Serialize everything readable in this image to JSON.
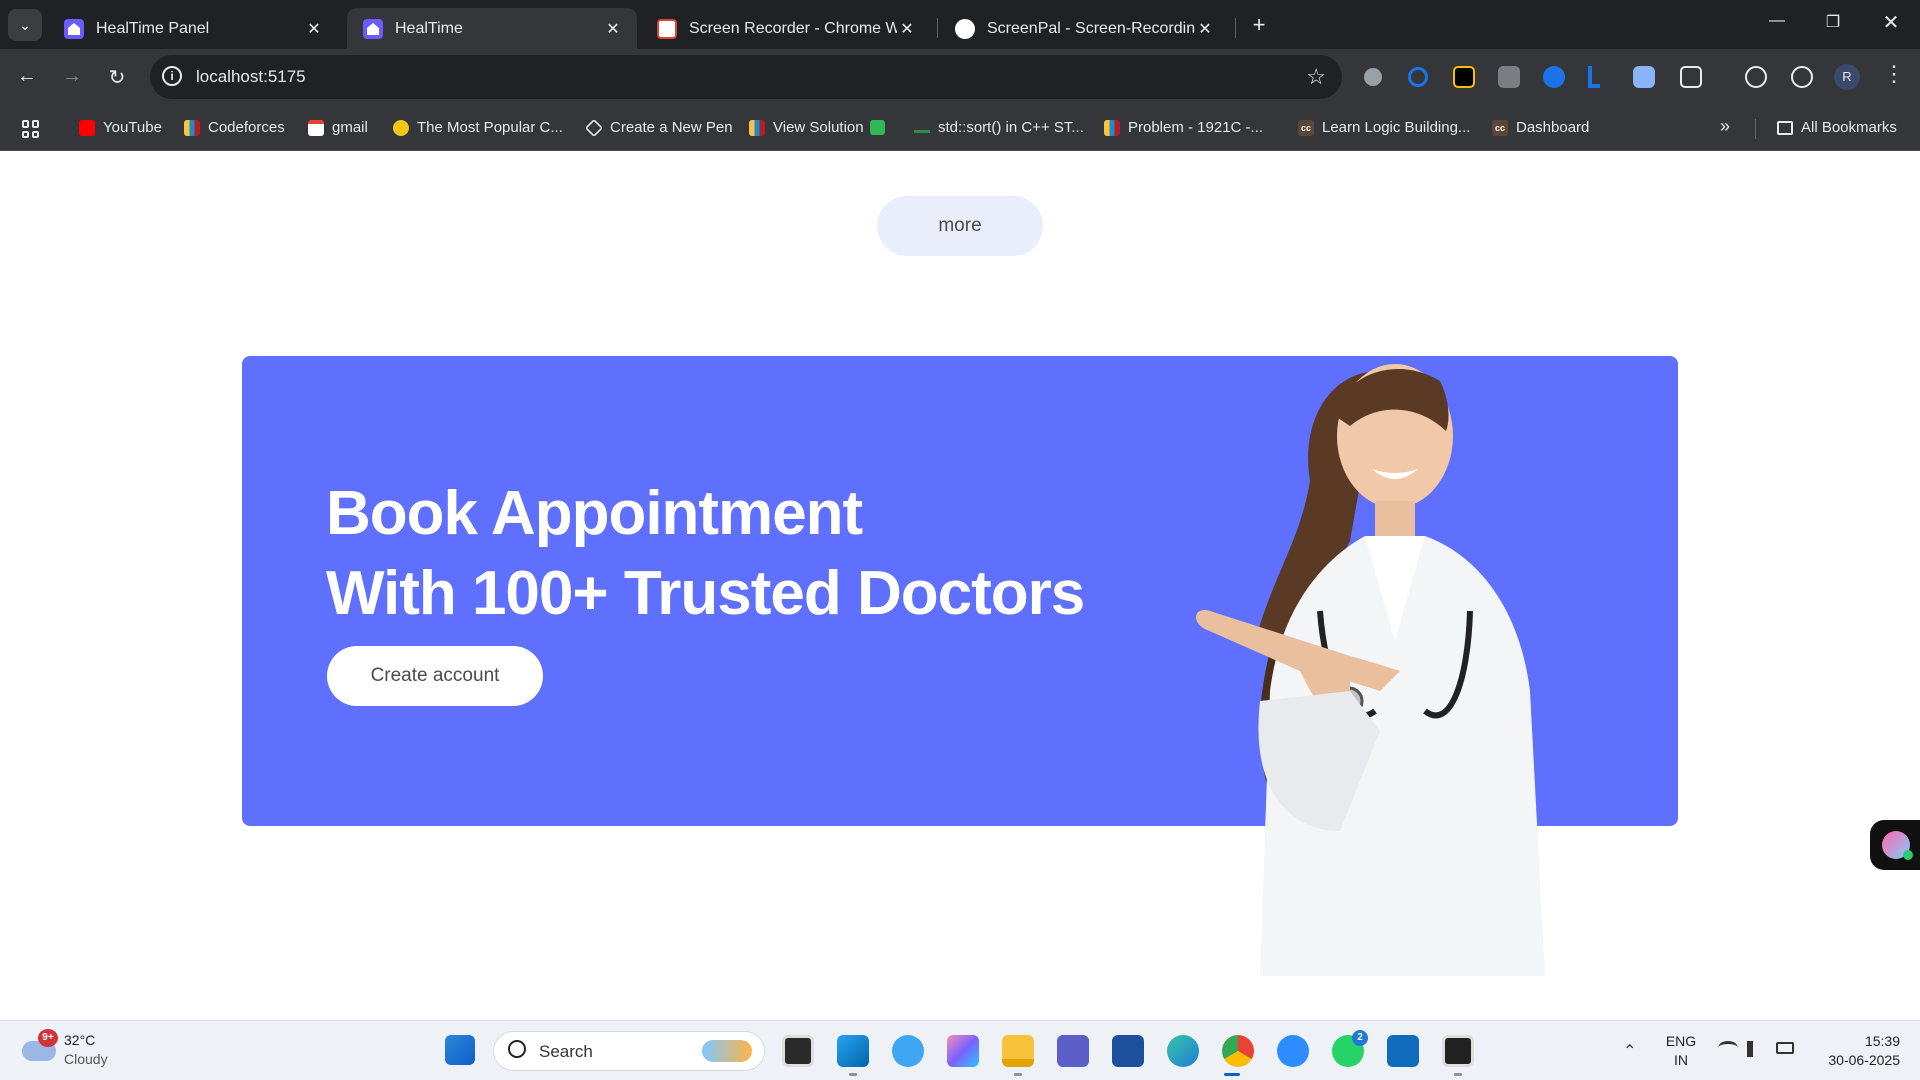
{
  "browser": {
    "tabs": [
      {
        "title": "HealTime Panel",
        "active": false
      },
      {
        "title": "HealTime",
        "active": true
      },
      {
        "title": "Screen Recorder - Chrome Web",
        "active": false
      },
      {
        "title": "ScreenPal - Screen-Recording",
        "active": false
      }
    ],
    "url": "localhost:5175",
    "bookmarks": [
      {
        "label": "YouTube",
        "icon": "youtube-icon"
      },
      {
        "label": "Codeforces",
        "icon": "codeforces-icon"
      },
      {
        "label": "gmail",
        "icon": "gmail-icon"
      },
      {
        "label": "The Most Popular C...",
        "icon": "bee-icon"
      },
      {
        "label": "Create a New Pen",
        "icon": "codepen-icon"
      },
      {
        "label": "View Solution",
        "icon": "codeforces-icon"
      },
      {
        "label": "std::sort() in C++ ST...",
        "icon": "geeksforgeeks-icon"
      },
      {
        "label": "Problem - 1921C -...",
        "icon": "codeforces-icon"
      },
      {
        "label": "Learn Logic Building...",
        "icon": "codechef-icon"
      },
      {
        "label": "Dashboard",
        "icon": "codechef-icon"
      }
    ],
    "all_bookmarks": "All Bookmarks",
    "profile_initial": "R"
  },
  "page": {
    "more_label": "more",
    "banner": {
      "line1": "Book Appointment",
      "line2": "With 100+ Trusted Doctors",
      "cta_label": "Create account",
      "background": "#5f6ffe"
    }
  },
  "taskbar": {
    "weather": {
      "temp": "32°C",
      "condition": "Cloudy",
      "badge": "9+"
    },
    "search_placeholder": "Search",
    "whatsapp_badge": "2",
    "language": {
      "line1": "ENG",
      "line2": "IN"
    },
    "time": "15:39",
    "date": "30-06-2025"
  }
}
